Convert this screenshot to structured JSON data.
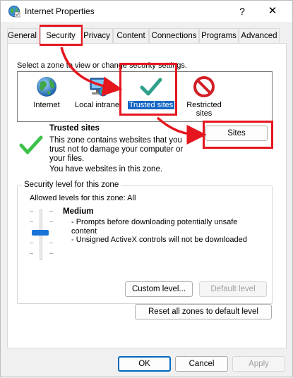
{
  "window": {
    "title": "Internet Properties",
    "help_label": "?",
    "close_label": "✕",
    "icon": "internet-globe-icon"
  },
  "tabs": [
    {
      "label": "General",
      "active": false
    },
    {
      "label": "Security",
      "active": true
    },
    {
      "label": "Privacy",
      "active": false
    },
    {
      "label": "Content",
      "active": false
    },
    {
      "label": "Connections",
      "active": false
    },
    {
      "label": "Programs",
      "active": false
    },
    {
      "label": "Advanced",
      "active": false
    }
  ],
  "zones": {
    "prompt": "Select a zone to view or change security settings.",
    "items": [
      {
        "label": "Internet",
        "icon": "globe-icon"
      },
      {
        "label": "Local intranet",
        "icon": "intranet-icon"
      },
      {
        "label": "Trusted sites",
        "icon": "checkmark-icon",
        "selected": true
      },
      {
        "label": "Restricted sites",
        "icon": "no-entry-icon"
      }
    ]
  },
  "zone_info": {
    "title": "Trusted sites",
    "description": "This zone contains websites that you trust not to damage your computer or your files.",
    "note": "You have websites in this zone.",
    "sites_button": "Sites"
  },
  "security_level": {
    "group_label": "Security level for this zone",
    "allowed": "Allowed levels for this zone: All",
    "level_name": "Medium",
    "bullets": [
      "- Prompts before downloading potentially unsafe content",
      "- Unsigned ActiveX controls will not be downloaded"
    ],
    "custom_level_button": "Custom level...",
    "default_level_button": "Default level",
    "reset_button": "Reset all zones to default level"
  },
  "footer": {
    "ok": "OK",
    "cancel": "Cancel",
    "apply": "Apply"
  },
  "colors": {
    "accent": "#1466c4",
    "callout": "#e5161e",
    "slider_thumb": "#1a73d8"
  }
}
